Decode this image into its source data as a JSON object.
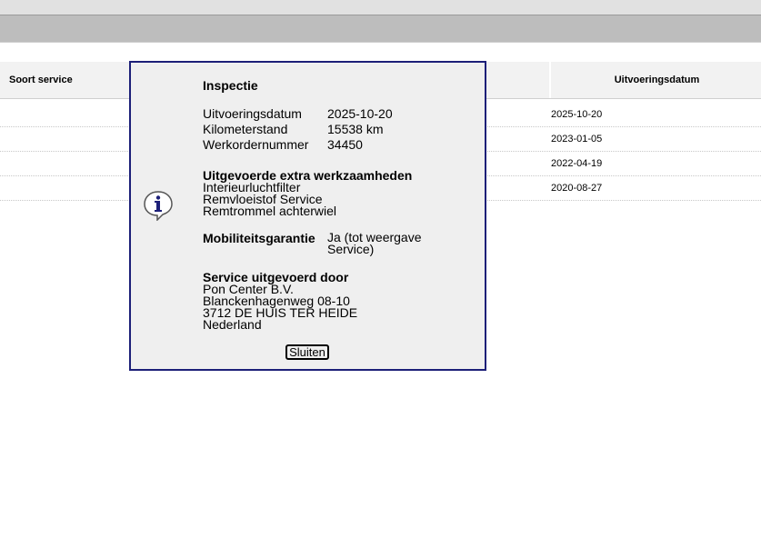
{
  "table": {
    "headers": {
      "soort_service": "Soort service",
      "uitvoeringsdatum": "Uitvoeringsdatum"
    },
    "rows": [
      {
        "date": "2025-10-20"
      },
      {
        "date": "2023-01-05"
      },
      {
        "date": "2022-04-19"
      },
      {
        "date": "2020-08-27"
      }
    ]
  },
  "dialog": {
    "title": "Inspectie",
    "icon": "info-icon",
    "details": [
      {
        "label": "Uitvoeringsdatum",
        "value": "2025-10-20"
      },
      {
        "label": "Kilometerstand",
        "value": "15538 km"
      },
      {
        "label": "Werkordernummer",
        "value": "34450"
      }
    ],
    "extra_work": {
      "heading": "Uitgevoerde extra werkzaamheden",
      "items": [
        "Interieurluchtfilter",
        "Remvloeistof Service",
        "Remtrommel achterwiel"
      ]
    },
    "mobility": {
      "label": "Mobiliteitsgarantie",
      "value": "Ja (tot weergave Service)"
    },
    "service_by": {
      "heading": "Service uitgevoerd door",
      "lines": [
        "Pon Center B.V.",
        "Blanckenhagenweg 08-10",
        "3712 DE HUIS TER HEIDE",
        "Nederland"
      ]
    },
    "close_label": "Sluiten"
  },
  "colors": {
    "dialog_border": "#1c1f78",
    "dialog_bg": "#efefef",
    "header_bg": "#f2f2f2"
  }
}
